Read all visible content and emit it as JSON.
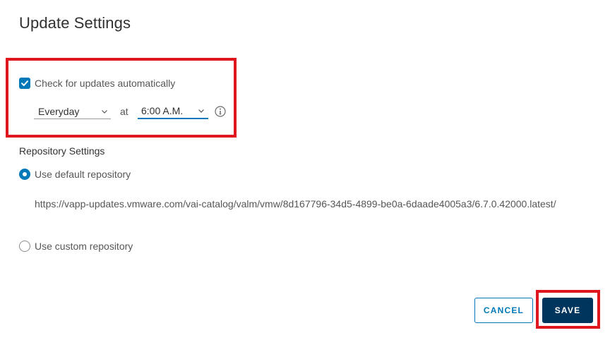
{
  "dialog": {
    "title": "Update Settings"
  },
  "auto_check": {
    "label": "Check for updates automatically",
    "checked": true,
    "frequency": "Everyday",
    "at_label": "at",
    "time": "6:00 A.M."
  },
  "repository": {
    "section_label": "Repository Settings",
    "default_label": "Use default repository",
    "default_selected": true,
    "default_url": "https://vapp-updates.vmware.com/vai-catalog/valm/vmw/8d167796-34d5-4899-be0a-6daade4005a3/6.7.0.42000.latest/",
    "custom_label": "Use custom repository",
    "custom_selected": false
  },
  "footer": {
    "cancel_label": "CANCEL",
    "save_label": "SAVE"
  },
  "colors": {
    "accent": "#0079b8",
    "primary_button": "#00365e",
    "highlight": "#e0161f"
  },
  "icons": {
    "checkbox": "checkmark-icon",
    "dropdown": "chevron-down-icon",
    "info": "info-icon"
  }
}
